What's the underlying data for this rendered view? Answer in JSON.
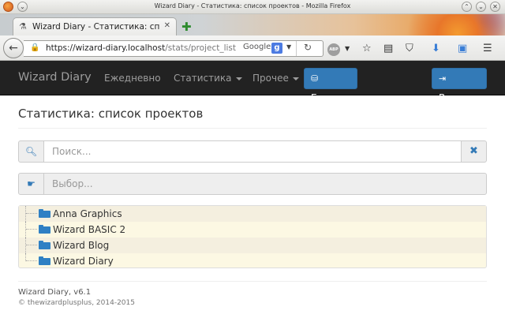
{
  "window": {
    "title": "Wizard Diary - Статистика: список проектов - Mozilla Firefox"
  },
  "browser": {
    "tab_title": "Wizard Diary - Статистика: спис…",
    "url_host": "https://wizard-diary.localhost",
    "url_path": "/stats/project_list",
    "search_engine": "Google"
  },
  "navbar": {
    "brand": "Wizard Diary",
    "items": [
      {
        "label": "Ежедневно"
      },
      {
        "label": "Статистика"
      },
      {
        "label": "Прочее"
      }
    ],
    "backup_label": "Бекап",
    "logout_label": "Выход"
  },
  "page": {
    "title": "Статистика: список проектов",
    "search_placeholder": "Поиск...",
    "select_placeholder": "Выбор..."
  },
  "projects": [
    {
      "name": "Anna Graphics"
    },
    {
      "name": "Wizard BASIC 2"
    },
    {
      "name": "Wizard Blog"
    },
    {
      "name": "Wizard Diary"
    }
  ],
  "footer": {
    "version": "Wizard Diary, v6.1",
    "copyright": "© thewizardplusplus, 2014-2015"
  },
  "colors": {
    "navbar_bg": "#222222",
    "primary": "#337ab7",
    "tree_bg": "#fcf8e3",
    "folder": "#2f80c4"
  },
  "icons": {
    "search": "search-icon",
    "clear": "times-icon",
    "select": "hand-pointer-icon",
    "folder": "folder-open-icon",
    "backup": "archive-icon",
    "logout": "sign-out-icon"
  }
}
